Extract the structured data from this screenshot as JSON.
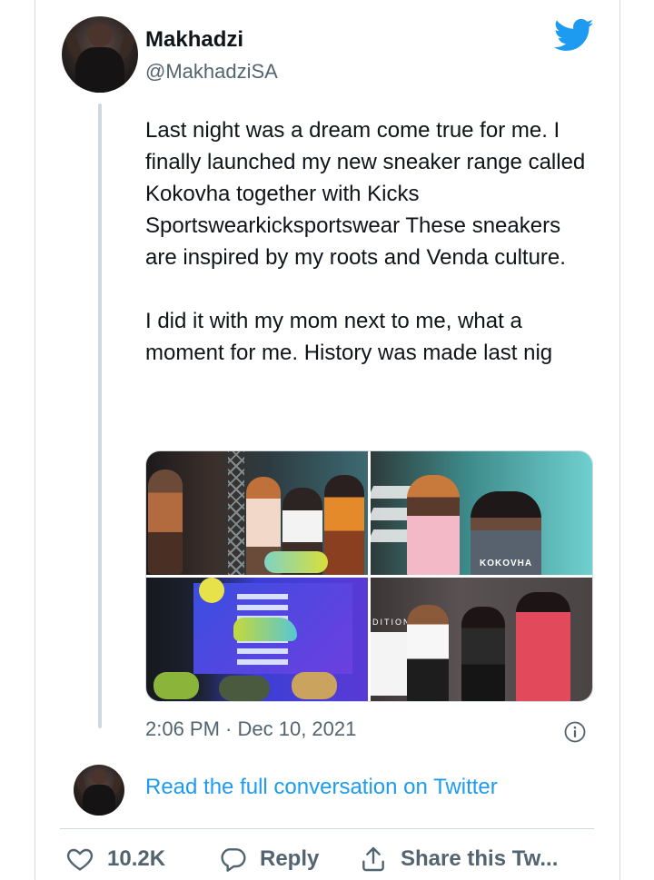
{
  "author": {
    "name": "Makhadzi",
    "handle": "@MakhadziSA"
  },
  "tweet": {
    "paragraphs": [
      "Last night was a dream come true for me. I finally launched my new sneaker range called Kokovha together with Kicks Sportswearkicksportswear These sneakers are inspired by my roots and Venda culture.",
      "I did it with my mom next to me, what a moment for me. History was made last nig"
    ],
    "photo_brand_text": "KOKOVHA",
    "photo_sign_text": "DITION",
    "timestamp": "2:06 PM · Dec 10, 2021"
  },
  "footer": {
    "read_link": "Read the full conversation on Twitter",
    "likes": "10.2K",
    "reply_label": "Reply",
    "share_label": "Share this Tw..."
  },
  "colors": {
    "accent": "#1d9bf0",
    "muted": "#536471",
    "border": "#cfd9de"
  },
  "icons": [
    "twitter-bird-icon",
    "info-icon",
    "heart-icon",
    "reply-bubble-icon",
    "share-icon"
  ]
}
